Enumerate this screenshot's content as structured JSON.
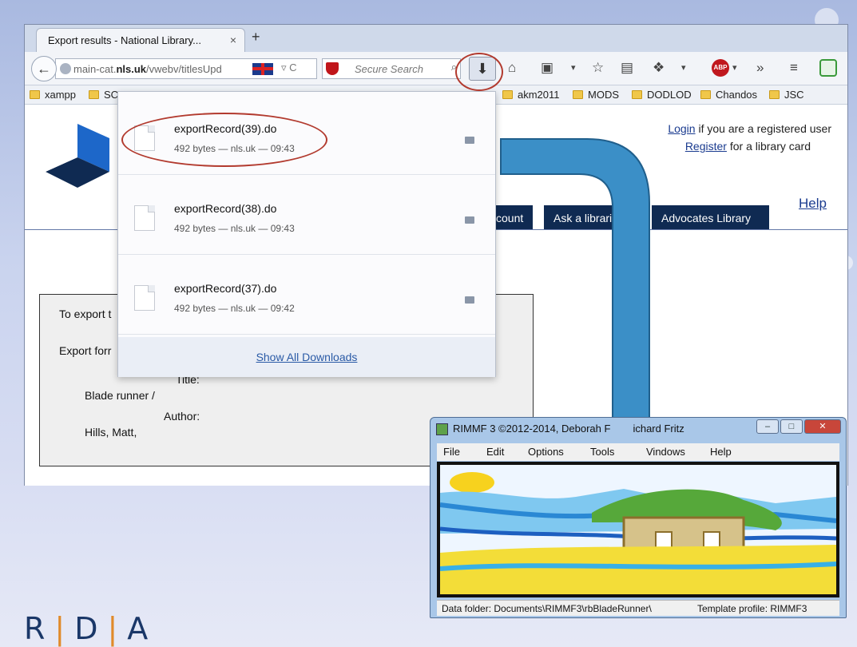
{
  "browser": {
    "tab_title": "Export results - National Library...",
    "tab_close": "×",
    "new_tab": "+",
    "url_host_pre": "main-cat.",
    "url_host_bold": "nls.uk",
    "url_path": "/vwebv/titlesUpd",
    "search_placeholder": "Secure Search",
    "bookmarks": [
      "xampp",
      "SC",
      "akm2011",
      "MODS",
      "DODLOD",
      "Chandos",
      "JSC"
    ]
  },
  "page": {
    "login_link": "Login",
    "login_text": " if you are a registered user",
    "register_link": "Register",
    "register_text": " for a library card",
    "help": "Help",
    "nav_tabs": [
      "count",
      "Ask a libraria",
      "Advocates Library"
    ],
    "export_intro": "To export t",
    "export_format": "Export forr",
    "title_label": "Title:",
    "title_value": "Blade runner /",
    "author_label": "Author:",
    "author_value": "Hills, Matt,"
  },
  "downloads": {
    "items": [
      {
        "name": "exportRecord(39).do",
        "meta": "492 bytes — nls.uk — 09:43"
      },
      {
        "name": "exportRecord(38).do",
        "meta": "492 bytes — nls.uk — 09:43"
      },
      {
        "name": "exportRecord(37).do",
        "meta": "492 bytes — nls.uk — 09:42"
      }
    ],
    "show_all": "Show All Downloads"
  },
  "rimmf": {
    "title": "RIMMF 3   ©2012-2014, Deborah F",
    "title_tail": "ichard Fritz",
    "menu": [
      "File",
      "Edit",
      "Options",
      "Tools",
      "Vindows",
      "Help"
    ],
    "status_left": "Data folder: Documents\\RIMMF3\\rbBladeRunner\\",
    "status_right": "Template profile: RIMMF3"
  },
  "logo_text": {
    "r": "R",
    "d": "D",
    "a": "A"
  },
  "colors": {
    "annotation": "#b23a2e",
    "arrow": "#3b8fc7",
    "nav_dark": "#0f2a52",
    "link": "#1a3b8f"
  }
}
